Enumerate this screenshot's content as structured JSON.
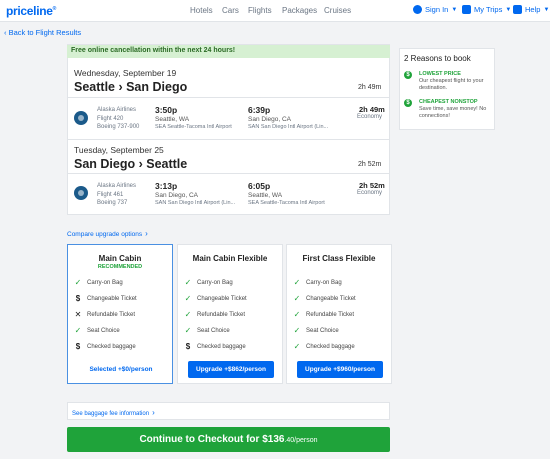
{
  "header": {
    "logo": "priceline",
    "nav": [
      "Hotels",
      "Cars",
      "Flights",
      "Packages",
      "Cruises"
    ],
    "sign_in": "Sign In",
    "my_trips": "My Trips",
    "help": "Help"
  },
  "back_link": "‹ Back to Flight Results",
  "banner": "Free online cancellation within the next 24 hours!",
  "outbound": {
    "date": "Wednesday, September 19",
    "route": "Seattle › San Diego",
    "total_duration": "2h 49m",
    "airline": "Alaska Airlines",
    "flight": "Flight 420",
    "aircraft": "Boeing 737-900",
    "dep_time": "3:50p",
    "dep_city": "Seattle, WA",
    "dep_airport": "SEA Seattle-Tacoma Intl Airport",
    "arr_time": "6:39p",
    "arr_city": "San Diego, CA",
    "arr_airport": "SAN San Diego Intl Airport (Lin...",
    "seg_duration": "2h 49m",
    "cabin": "Economy"
  },
  "return": {
    "date": "Tuesday, September 25",
    "route": "San Diego › Seattle",
    "total_duration": "2h 52m",
    "airline": "Alaska Airlines",
    "flight": "Flight 461",
    "aircraft": "Boeing 737",
    "dep_time": "3:13p",
    "dep_city": "San Diego, CA",
    "dep_airport": "SAN San Diego Intl Airport (Lin...",
    "arr_time": "6:05p",
    "arr_city": "Seattle, WA",
    "arr_airport": "SEA Seattle-Tacoma Intl Airport",
    "seg_duration": "2h 52m",
    "cabin": "Economy"
  },
  "reasons": {
    "title": "2 Reasons to book",
    "items": [
      {
        "title": "LOWEST PRICE",
        "desc": "Our cheapest flight to your destination."
      },
      {
        "title": "CHEAPEST NONSTOP",
        "desc": "Save time, save money! No connections!"
      }
    ]
  },
  "upgrade_link": "Compare upgrade options",
  "plans": [
    {
      "name": "Main Cabin",
      "tag": "RECOMMENDED",
      "features": [
        "Carry-on Bag",
        "Changeable Ticket",
        "Refundable Ticket",
        "Seat Choice",
        "Checked baggage"
      ],
      "button": "Selected +$0/person"
    },
    {
      "name": "Main Cabin Flexible",
      "tag": "",
      "features": [
        "Carry-on Bag",
        "Changeable Ticket",
        "Refundable Ticket",
        "Seat Choice",
        "Checked baggage"
      ],
      "button": "Upgrade +$862/person"
    },
    {
      "name": "First Class Flexible",
      "tag": "",
      "features": [
        "Carry-on Bag",
        "Changeable Ticket",
        "Refundable Ticket",
        "Seat Choice",
        "Checked baggage"
      ],
      "button": "Upgrade +$960/person"
    }
  ],
  "baggage_link": "See baggage fee information",
  "checkout": {
    "label": "Continue to Checkout for $136",
    "cents": ".40/person"
  },
  "colors": {
    "brand": "#0068ef",
    "success": "#1fa33a"
  }
}
